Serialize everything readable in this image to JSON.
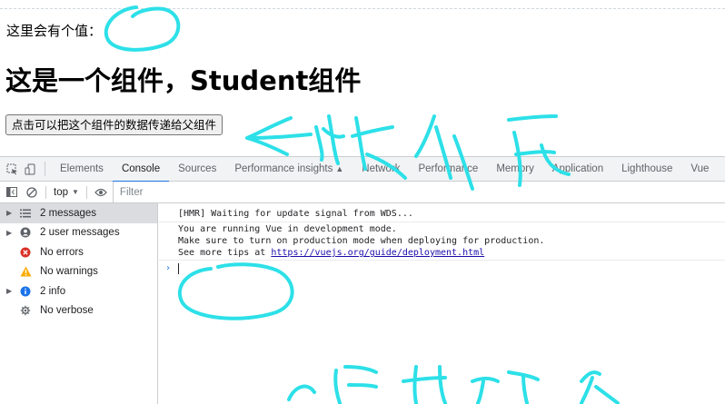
{
  "page": {
    "value_line": "这里会有个值：",
    "component_title": "这是一个组件，Student组件",
    "send_button_label": "点击可以把这个组件的数据传递给父组件"
  },
  "devtools": {
    "tabs": [
      {
        "label": "Elements",
        "active": false
      },
      {
        "label": "Console",
        "active": true
      },
      {
        "label": "Sources",
        "active": false
      },
      {
        "label": "Performance insights",
        "active": false
      },
      {
        "label": "Network",
        "active": false
      },
      {
        "label": "Performance",
        "active": false
      },
      {
        "label": "Memory",
        "active": false
      },
      {
        "label": "Application",
        "active": false
      },
      {
        "label": "Lighthouse",
        "active": false
      },
      {
        "label": "Vue",
        "active": false
      }
    ],
    "toolbar": {
      "context": "top",
      "filter_placeholder": "Filter"
    },
    "sidebar": [
      {
        "label": "2 messages",
        "icon": "list-icon",
        "expandable": true,
        "selected": true
      },
      {
        "label": "2 user messages",
        "icon": "user-icon",
        "expandable": true,
        "selected": false
      },
      {
        "label": "No errors",
        "icon": "error-icon",
        "expandable": false,
        "selected": false
      },
      {
        "label": "No warnings",
        "icon": "warning-icon",
        "expandable": false,
        "selected": false
      },
      {
        "label": "2 info",
        "icon": "info-icon",
        "expandable": true,
        "selected": false
      },
      {
        "label": "No verbose",
        "icon": "bug-icon",
        "expandable": false,
        "selected": false
      }
    ],
    "console": {
      "hmr_message": "[HMR] Waiting for update signal from WDS...",
      "vue_line1": "You are running Vue in development mode.",
      "vue_line2": "Make sure to turn on production mode when deploying for production.",
      "vue_line3_prefix": "See more tips at ",
      "vue_link": "https://vuejs.org/guide/deployment.html"
    },
    "colors": {
      "accent": "#1a73e8",
      "error": "#d93025",
      "warning": "#f9ab00",
      "info": "#1a73e8",
      "annotation": "#2de0e8"
    }
  }
}
